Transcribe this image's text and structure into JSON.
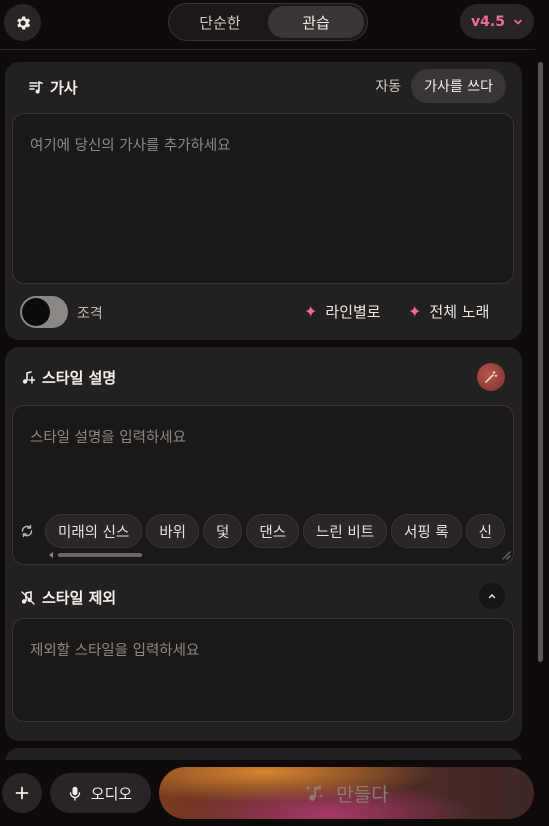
{
  "topbar": {
    "mode_options": [
      "단순한",
      "관습"
    ],
    "active_mode": "관습",
    "version": "v4.5"
  },
  "lyrics": {
    "title": "가사",
    "mode_auto": "자동",
    "mode_write": "가사를 쓰다",
    "placeholder": "여기에 당신의 가사를 추가하세요",
    "toggle_label": "조격",
    "toggle_on": false,
    "by_line_label": "라인별로",
    "full_song_label": "전체 노래"
  },
  "style": {
    "title": "스타일 설명",
    "placeholder": "스타일 설명을 입력하세요",
    "chips": [
      "미래의 신스",
      "바위",
      "덫",
      "댄스",
      "느린 비트",
      "서핑 록",
      "신"
    ]
  },
  "exclude": {
    "title": "스타일 제외",
    "placeholder": "제외할 스타일을 입력하세요"
  },
  "bottom": {
    "audio_label": "오디오",
    "create_label": "만들다"
  },
  "colors": {
    "accent_pink": "#f06aa0",
    "panel": "#232020",
    "background": "#0e0a0a"
  },
  "icons": {
    "settings": "gear-icon",
    "version_dropdown": "chevron-down-icon",
    "lyrics": "lyrics-note-icon",
    "style": "music-note-plus-icon",
    "exclude": "music-note-minus-icon",
    "magic": "magic-wand-icon",
    "refresh": "refresh-icon",
    "collapse": "chevron-up-icon",
    "add": "plus-icon",
    "audio": "microphone-icon",
    "create": "sparkle-note-icon"
  }
}
